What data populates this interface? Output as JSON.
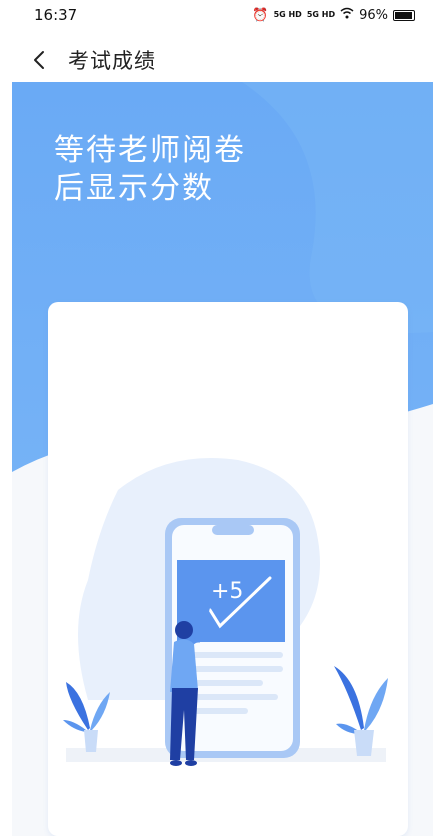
{
  "status": {
    "time": "16:37",
    "signal1": "5G HD",
    "signal2": "5G HD",
    "battery": "96%",
    "battery_level": 0.96
  },
  "nav": {
    "back_icon": "chevron-left-icon",
    "title": "考试成绩"
  },
  "hero": {
    "line1": "等待老师阅卷",
    "line2": "后显示分数"
  },
  "illustration": {
    "score_text": "+5"
  },
  "colors": {
    "hero_blue": "#6aaaf5",
    "accent_blue": "#5b95ee",
    "figure_dark": "#1f3fa3"
  }
}
